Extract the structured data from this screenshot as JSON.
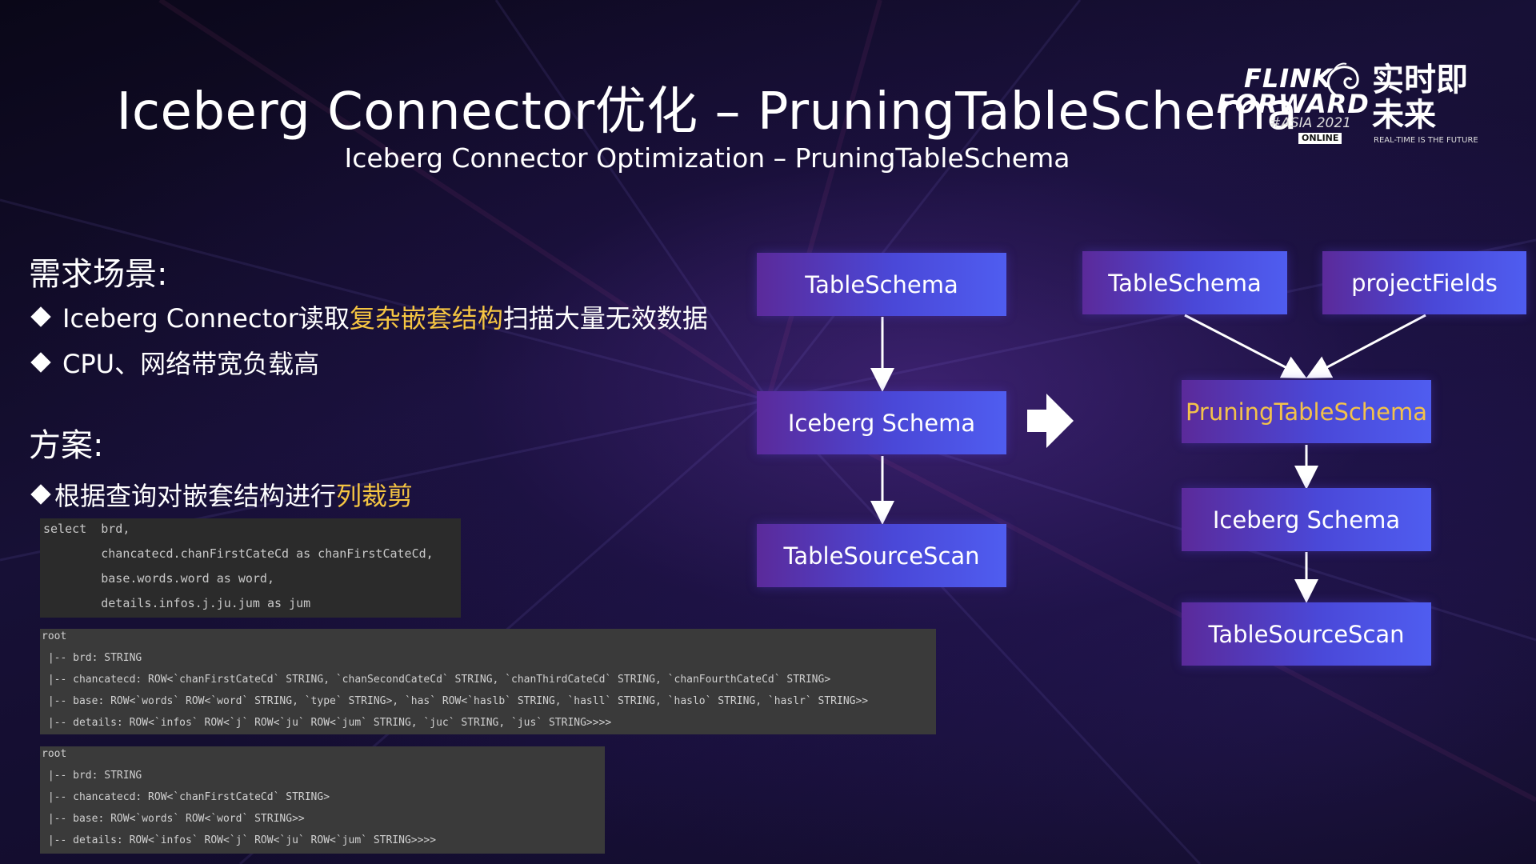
{
  "slide": {
    "title": "Iceberg Connector优化 – PruningTableSchema",
    "subtitle": "Iceberg Connector Optimization – PruningTableSchema"
  },
  "logo": {
    "flink": "FLINK",
    "forward": "FORWARD",
    "asia": "#ASIA 2021",
    "online": "ONLINE",
    "cn_title": "实时即未来",
    "tagline": "REAL-TIME IS THE FUTURE"
  },
  "requirements": {
    "heading": "需求场景:",
    "bullets": [
      {
        "pre": "Iceberg Connector读取",
        "highlight": "复杂嵌套结构",
        "post": "扫描大量无效数据"
      },
      {
        "pre": "CPU、网络带宽负载高",
        "highlight": "",
        "post": ""
      }
    ]
  },
  "solution": {
    "heading": "方案:",
    "bullet": {
      "pre": "根据查询对嵌套结构进行",
      "highlight": "列裁剪"
    }
  },
  "sql": [
    "select  brd,",
    "        chancatecd.chanFirstCateCd as chanFirstCateCd,",
    "        base.words.word as word,",
    "        details.infos.j.ju.jum as jum"
  ],
  "schema_full": [
    "root",
    " |-- brd: STRING",
    " |-- chancatecd: ROW<`chanFirstCateCd` STRING, `chanSecondCateCd` STRING, `chanThirdCateCd` STRING, `chanFourthCateCd` STRING>",
    " |-- base: ROW<`words` ROW<`word` STRING, `type` STRING>, `has` ROW<`haslb` STRING, `hasll` STRING, `haslo` STRING, `haslr` STRING>>",
    " |-- details: ROW<`infos` ROW<`j` ROW<`ju` ROW<`jum` STRING, `juc` STRING, `jus` STRING>>>>"
  ],
  "schema_pruned": [
    "root",
    " |-- brd: STRING",
    " |-- chancatecd: ROW<`chanFirstCateCd` STRING>",
    " |-- base: ROW<`words` ROW<`word` STRING>>",
    " |-- details: ROW<`infos` ROW<`j` ROW<`ju` ROW<`jum` STRING>>>>"
  ],
  "diagram_before": {
    "nodes": [
      "TableSchema",
      "Iceberg Schema",
      "TableSourceScan"
    ]
  },
  "diagram_after": {
    "nodes": [
      "TableSchema",
      "projectFields",
      "PruningTableSchema",
      "Iceberg Schema",
      "TableSourceScan"
    ]
  },
  "colors": {
    "highlight": "#f5c542",
    "box_start": "#5b2a9a",
    "box_end": "#4f5df0"
  }
}
